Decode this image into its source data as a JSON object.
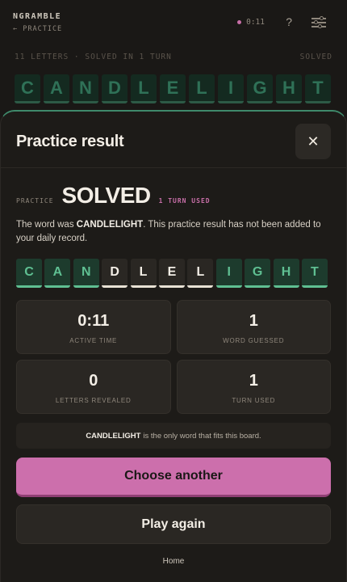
{
  "header": {
    "brand": "NGRAMBLE",
    "back_link": "← PRACTICE",
    "timer": "0:11",
    "help_label": "?"
  },
  "board": {
    "status_left": "11 LETTERS · SOLVED IN 1 TURN",
    "status_right": "SOLVED",
    "letters": [
      "C",
      "A",
      "N",
      "D",
      "L",
      "E",
      "L",
      "I",
      "G",
      "H",
      "T"
    ]
  },
  "sheet": {
    "title": "Practice result",
    "close_label": "✕",
    "mode_label": "PRACTICE",
    "result": "SOLVED",
    "turns_used": "1 TURN USED",
    "desc_prefix": "The word was ",
    "word": "CANDLELIGHT",
    "desc_suffix": ". This practice result has not been added to your daily record.",
    "tiles": [
      {
        "letter": "C",
        "state": "green"
      },
      {
        "letter": "A",
        "state": "green"
      },
      {
        "letter": "N",
        "state": "green"
      },
      {
        "letter": "D",
        "state": "white"
      },
      {
        "letter": "L",
        "state": "white"
      },
      {
        "letter": "E",
        "state": "white"
      },
      {
        "letter": "L",
        "state": "white"
      },
      {
        "letter": "I",
        "state": "green"
      },
      {
        "letter": "G",
        "state": "green"
      },
      {
        "letter": "H",
        "state": "green"
      },
      {
        "letter": "T",
        "state": "green"
      }
    ],
    "stats": [
      {
        "value": "0:11",
        "label": "ACTIVE TIME"
      },
      {
        "value": "1",
        "label": "WORD GUESSED"
      },
      {
        "value": "0",
        "label": "LETTERS REVEALED"
      },
      {
        "value": "1",
        "label": "TURN USED"
      }
    ],
    "note_word": "CANDLELIGHT",
    "note_text": "is the only word that fits this board.",
    "primary_button": "Choose another",
    "secondary_button": "Play again",
    "home_link": "Home"
  },
  "colors": {
    "accent_pink": "#cc6fac",
    "tile_green": "#5fbf92",
    "background": "#1a1816"
  }
}
